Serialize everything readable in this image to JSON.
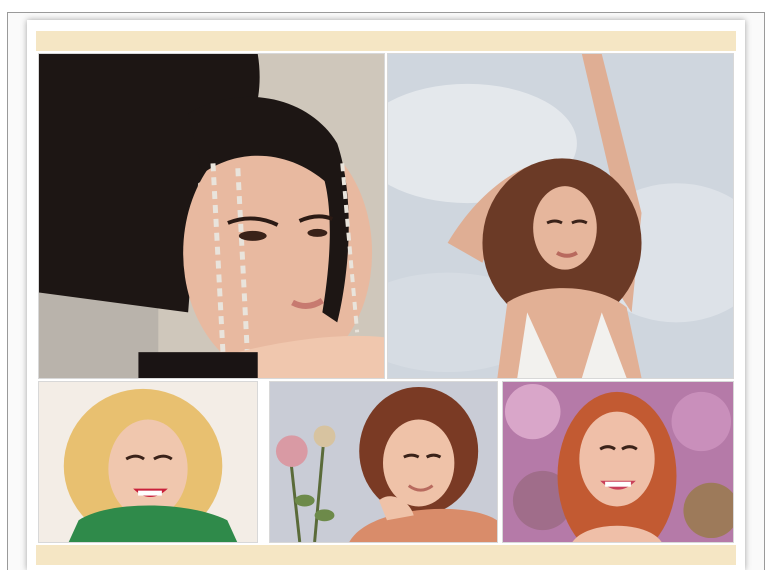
{
  "gallery": {
    "accent_band_color": "#f5e6c4",
    "photos": [
      {
        "icon": "portrait-photo-icon",
        "subject": "woman-braided-hair"
      },
      {
        "icon": "portrait-photo-icon",
        "subject": "woman-arms-raised-sky"
      },
      {
        "icon": "portrait-photo-icon",
        "subject": "woman-blonde-curls-smiling"
      },
      {
        "icon": "portrait-photo-icon",
        "subject": "woman-with-roses"
      },
      {
        "icon": "portrait-photo-icon",
        "subject": "woman-red-hair-blossoms"
      }
    ]
  }
}
